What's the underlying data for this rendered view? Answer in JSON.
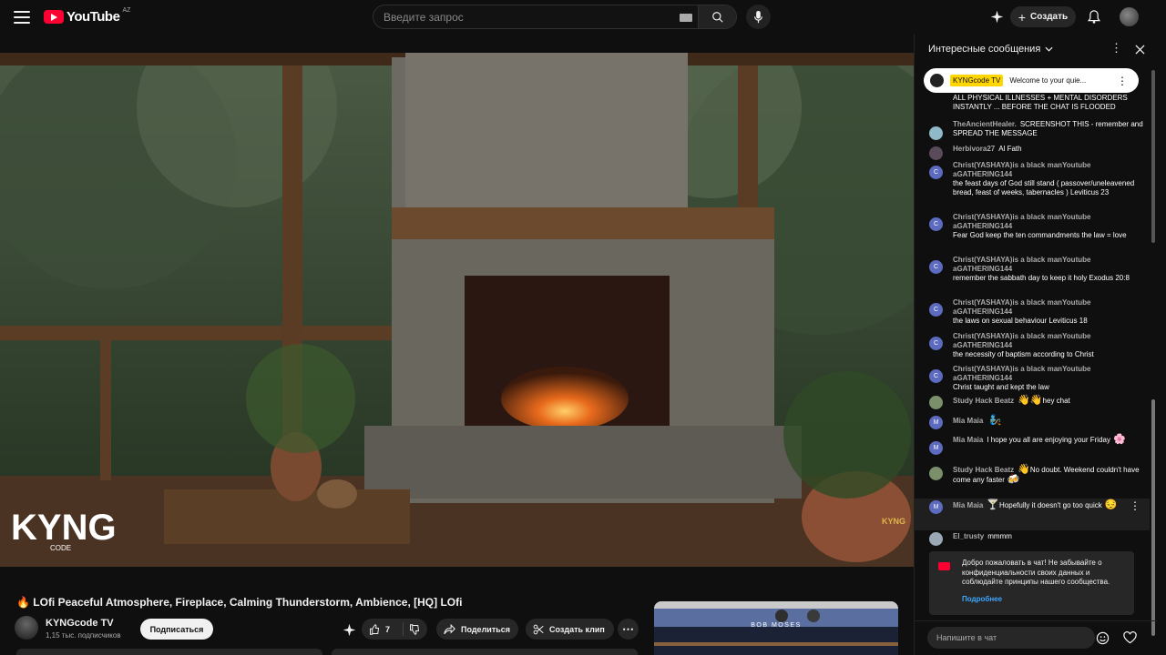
{
  "header": {
    "logo_text": "YouTube",
    "country_code": "AZ",
    "search_placeholder": "Введите запрос",
    "create_label": "Создать"
  },
  "video": {
    "title": "🔥 LOfi Peaceful Atmosphere, Fireplace, Calming Thunderstorm, Ambience, [HQ] LOfi",
    "watermark_left": "KYNG",
    "watermark_sub": "CODE",
    "watermark_right": "KYNG"
  },
  "channel": {
    "name": "KYNGcode TV",
    "subscribers": "1,15 тыс. подписчиков",
    "subscribe_label": "Подписаться"
  },
  "actions": {
    "like_count": "7",
    "share_label": "Поделиться",
    "clip_label": "Создать клип"
  },
  "recommendation": {
    "title_text": "BOB MOSES"
  },
  "chat": {
    "header_title": "Интересные сообщения",
    "pinned": {
      "author": "KYNGcode TV",
      "text": "Welcome to your quie..."
    },
    "messages": [
      {
        "author": "",
        "text": "ALL PHYSICAL ILLNESSES + MENTAL DISORDERS INSTANTLY ... BEFORE THE CHAT IS FLOODED",
        "avatar": "",
        "avatar_color": ""
      },
      {
        "author": "TheAncientHealer.",
        "text": "SCREENSHOT THIS - remember and SPREAD THE MESSAGE",
        "avatar": "",
        "avatar_color": "#8fb8c9"
      },
      {
        "author": "Herbivora27",
        "text": "Al Fath",
        "avatar": "",
        "avatar_color": "#5a4a5a"
      },
      {
        "author": "Christ(YASHAYA)is a black manYoutube aGATHERING144",
        "text": "the feast days of God still stand ( passover/uneleavened bread, feast of weeks, tabernacles ) Leviticus 23",
        "avatar": "C",
        "avatar_color": "#5c6bc0"
      },
      {
        "author": "Christ(YASHAYA)is a black manYoutube aGATHERING144",
        "text": "Fear God keep the ten commandments the law = love",
        "avatar": "C",
        "avatar_color": "#5c6bc0"
      },
      {
        "author": "Christ(YASHAYA)is a black manYoutube aGATHERING144",
        "text": "remember the sabbath day to keep it holy Exodus 20:8",
        "avatar": "C",
        "avatar_color": "#5c6bc0"
      },
      {
        "author": "Christ(YASHAYA)is a black manYoutube aGATHERING144",
        "text": "the laws on sexual behaviour Leviticus 18",
        "avatar": "C",
        "avatar_color": "#5c6bc0"
      },
      {
        "author": "Christ(YASHAYA)is a black manYoutube aGATHERING144",
        "text": "the necessity of baptism according to Christ",
        "avatar": "C",
        "avatar_color": "#5c6bc0"
      },
      {
        "author": "Christ(YASHAYA)is a black manYoutube aGATHERING144",
        "text": "Christ taught and kept the law",
        "avatar": "C",
        "avatar_color": "#5c6bc0"
      },
      {
        "author": "Study Hack Beatz",
        "text": "hey chat",
        "emoji_before": "👋👋",
        "avatar": "",
        "avatar_color": "#7a8f6a"
      },
      {
        "author": "Mia Maia",
        "text": "",
        "emoji_after": "🧞",
        "avatar": "M",
        "avatar_color": "#5c6bc0"
      },
      {
        "author": "Mia Maia",
        "text": "I hope you all are enjoying your Friday",
        "emoji_after": "🌸",
        "avatar": "M",
        "avatar_color": "#5c6bc0"
      },
      {
        "author": "Study Hack Beatz",
        "text": "No doubt. Weekend couldn't have come any faster",
        "emoji_before": "👋",
        "emoji_after": "🍻",
        "avatar": "",
        "avatar_color": "#7a8f6a"
      },
      {
        "author": "Mia Maia",
        "text": "Hopefully it doesn't go too quick",
        "emoji_before": "🍸",
        "emoji_after": "😔",
        "avatar": "M",
        "avatar_color": "#5c6bc0"
      },
      {
        "author": "El_trusty",
        "text": "mmmm",
        "avatar": "",
        "avatar_color": "#9aa8b5"
      }
    ],
    "welcome_text": "Добро пожаловать в чат! Не забывайте о конфиденциальности своих данных и соблюдайте принципы нашего сообщества.",
    "welcome_link": "Подробнее",
    "input_placeholder": "Напишите в чат"
  },
  "icons": [
    "menu-icon",
    "search-icon",
    "keyboard-icon",
    "mic-icon",
    "sparkle-icon",
    "plus-icon",
    "bell-icon",
    "more-icon",
    "close-icon",
    "chevron-down-icon",
    "like-icon",
    "dislike-icon",
    "share-icon",
    "scissors-icon",
    "emoji-icon",
    "heart-icon"
  ]
}
